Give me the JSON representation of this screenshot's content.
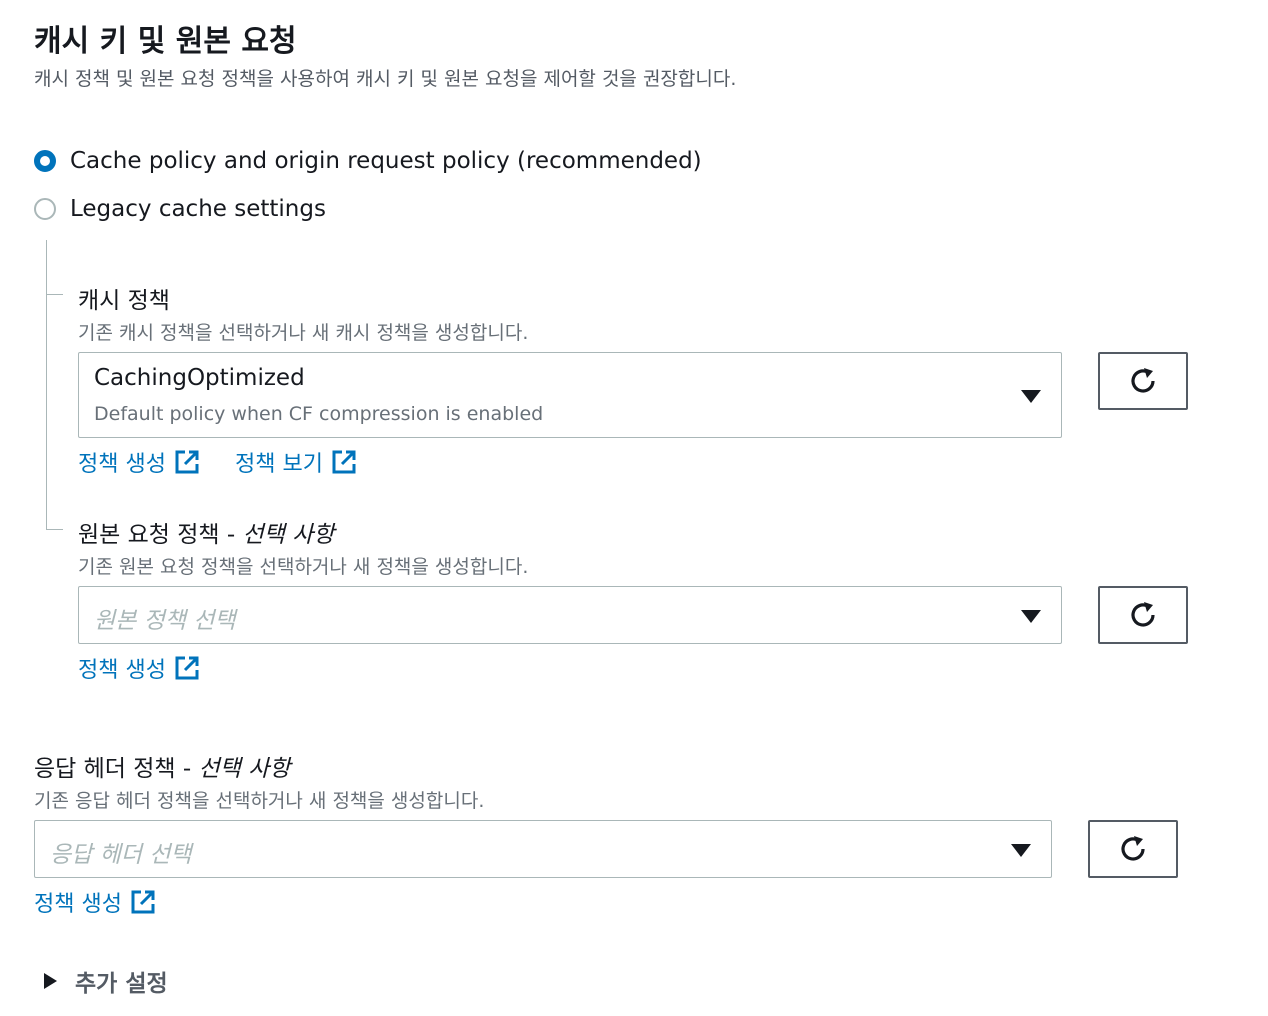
{
  "header": {
    "title": "캐시 키 및 원본 요청",
    "description": "캐시 정책 및 원본 요청 정책을 사용하여 캐시 키 및 원본 요청을 제어할 것을 권장합니다."
  },
  "options": [
    {
      "label": "Cache policy and origin request policy (recommended)",
      "selected": true
    },
    {
      "label": "Legacy cache settings",
      "selected": false
    }
  ],
  "cache_policy": {
    "label": "캐시 정책",
    "description": "기존 캐시 정책을 선택하거나 새 캐시 정책을 생성합니다.",
    "selected_name": "CachingOptimized",
    "selected_description": "Default policy when CF compression is enabled",
    "create_link": "정책 생성",
    "view_link": "정책 보기"
  },
  "origin_policy": {
    "label": "원본 요청 정책 - ",
    "optional": "선택 사항",
    "description": "기존 원본 요청 정책을 선택하거나 새 정책을 생성합니다.",
    "placeholder": "원본 정책 선택",
    "create_link": "정책 생성"
  },
  "response_policy": {
    "label": "응답 헤더 정책 - ",
    "optional": "선택 사항",
    "description": "기존 응답 헤더 정책을 선택하거나 새 정책을 생성합니다.",
    "placeholder": "응답 헤더 선택",
    "create_link": "정책 생성"
  },
  "additional": {
    "label": "추가 설정",
    "expanded": false
  },
  "colors": {
    "accent": "#0073bb",
    "text": "#16191f",
    "muted": "#687078",
    "border": "#aab7b8"
  }
}
